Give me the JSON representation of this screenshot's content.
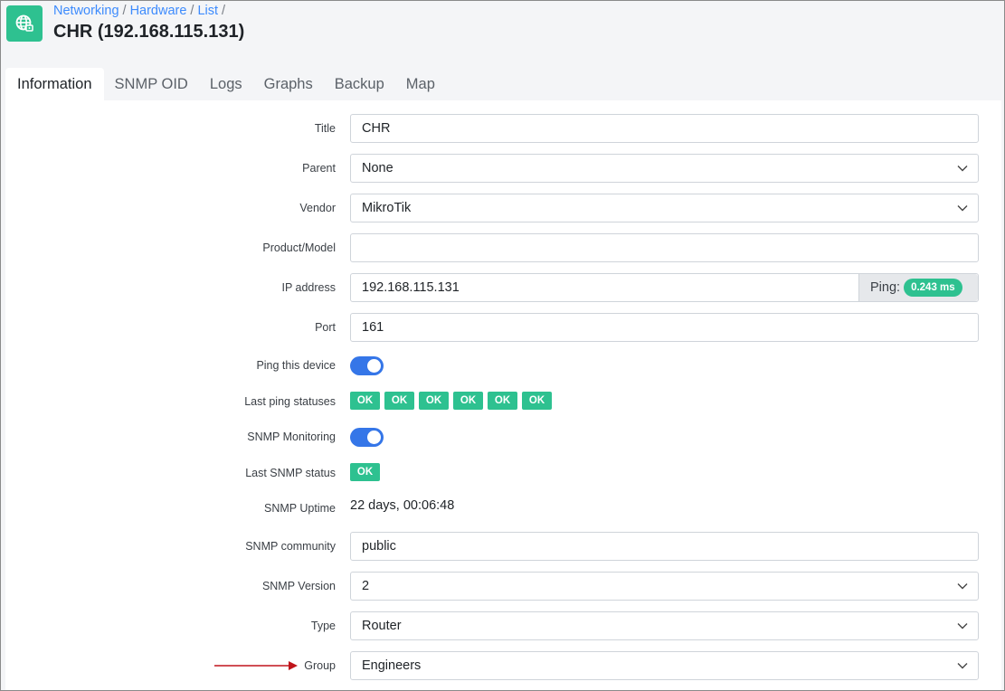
{
  "breadcrumb": [
    "Networking",
    "Hardware",
    "List"
  ],
  "page_title": "CHR (192.168.115.131)",
  "tabs": [
    "Information",
    "SNMP OID",
    "Logs",
    "Graphs",
    "Backup",
    "Map"
  ],
  "active_tab": "Information",
  "colors": {
    "accent": "#2ec190",
    "link": "#3d8bfd",
    "toggle": "#3576e8",
    "arrow": "#c0141b"
  },
  "icons": {
    "app": "globe-network-icon",
    "select": "chevron-down-icon"
  },
  "form": {
    "title": {
      "label": "Title",
      "value": "CHR"
    },
    "parent": {
      "label": "Parent",
      "value": "None"
    },
    "vendor": {
      "label": "Vendor",
      "value": "MikroTik"
    },
    "model": {
      "label": "Product/Model",
      "value": ""
    },
    "ip": {
      "label": "IP address",
      "value": "192.168.115.131",
      "ping_label": "Ping:",
      "ping_value": "0.243 ms"
    },
    "port": {
      "label": "Port",
      "value": "161"
    },
    "ping_device": {
      "label": "Ping this device",
      "enabled": true
    },
    "last_ping": {
      "label": "Last ping statuses",
      "statuses": [
        "OK",
        "OK",
        "OK",
        "OK",
        "OK",
        "OK"
      ]
    },
    "snmp_monitoring": {
      "label": "SNMP Monitoring",
      "enabled": true
    },
    "last_snmp": {
      "label": "Last SNMP status",
      "status": "OK"
    },
    "uptime": {
      "label": "SNMP Uptime",
      "value": "22 days, 00:06:48"
    },
    "community": {
      "label": "SNMP community",
      "value": "public"
    },
    "version": {
      "label": "SNMP Version",
      "value": "2"
    },
    "type": {
      "label": "Type",
      "value": "Router"
    },
    "group": {
      "label": "Group",
      "value": "Engineers"
    }
  }
}
